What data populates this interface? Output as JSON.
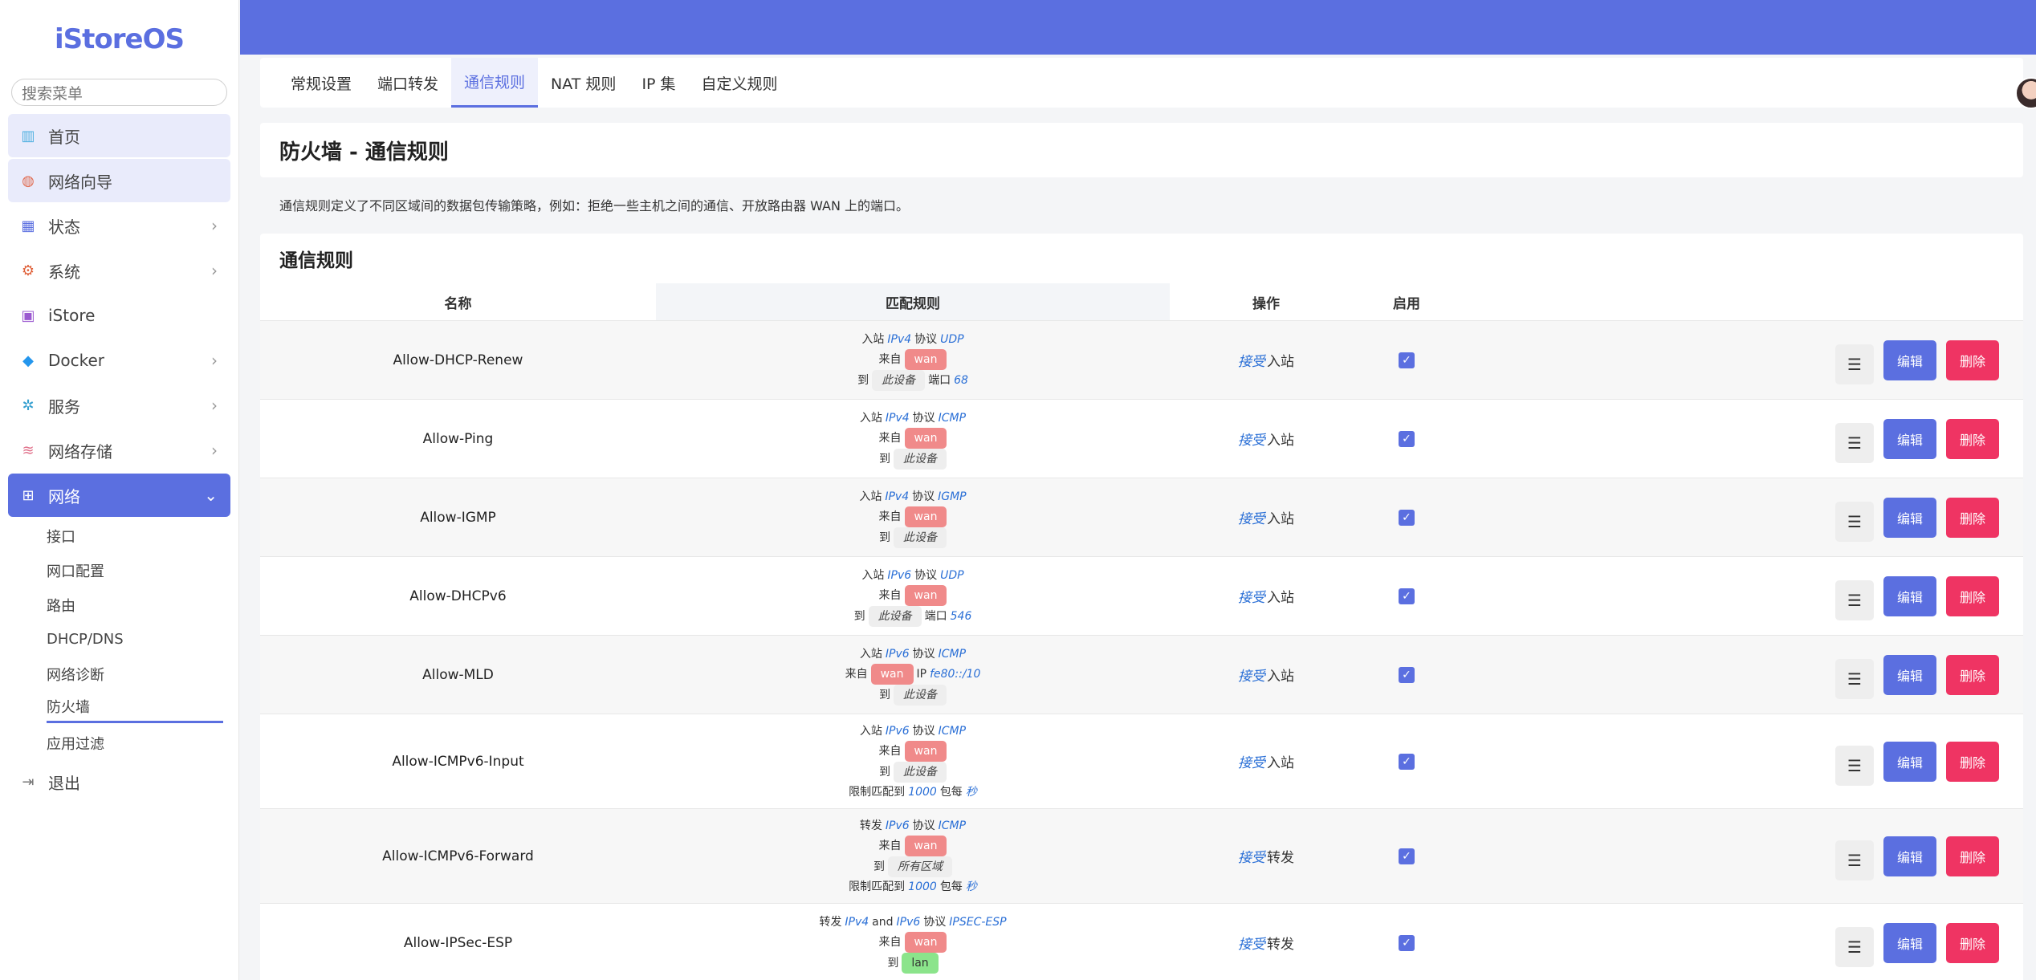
{
  "brand": "iStoreOS",
  "search": {
    "placeholder": "搜索菜单"
  },
  "sidebar": {
    "items": [
      {
        "label": "首页"
      },
      {
        "label": "网络向导"
      },
      {
        "label": "状态"
      },
      {
        "label": "系统"
      },
      {
        "label": "iStore"
      },
      {
        "label": "Docker"
      },
      {
        "label": "服务"
      },
      {
        "label": "网络存储"
      },
      {
        "label": "网络"
      }
    ],
    "sub": [
      "接口",
      "网口配置",
      "路由",
      "DHCP/DNS",
      "网络诊断",
      "防火墙",
      "应用过滤"
    ],
    "logout": "退出"
  },
  "tabs": [
    "常规设置",
    "端口转发",
    "通信规则",
    "NAT 规则",
    "IP 集",
    "自定义规则"
  ],
  "page_title": "防火墙 - 通信规则",
  "description": "通信规则定义了不同区域间的数据包传输策略，例如：拒绝一些主机之间的通信、开放路由器 WAN 上的端口。",
  "section_title": "通信规则",
  "table": {
    "headers": [
      "名称",
      "匹配规则",
      "操作",
      "启用"
    ],
    "rows": [
      {
        "name": "Allow-DHCP-Renew",
        "dir": "入站",
        "fam": "IPv4",
        "proto": "UDP",
        "from": "wan",
        "to": "此设备",
        "port": "68",
        "op_em": "接受",
        "op": "入站"
      },
      {
        "name": "Allow-Ping",
        "dir": "入站",
        "fam": "IPv4",
        "proto": "ICMP",
        "from": "wan",
        "to": "此设备",
        "op_em": "接受",
        "op": "入站"
      },
      {
        "name": "Allow-IGMP",
        "dir": "入站",
        "fam": "IPv4",
        "proto": "IGMP",
        "from": "wan",
        "to": "此设备",
        "op_em": "接受",
        "op": "入站"
      },
      {
        "name": "Allow-DHCPv6",
        "dir": "入站",
        "fam": "IPv6",
        "proto": "UDP",
        "from": "wan",
        "to": "此设备",
        "port": "546",
        "op_em": "接受",
        "op": "入站"
      },
      {
        "name": "Allow-MLD",
        "dir": "入站",
        "fam": "IPv6",
        "proto": "ICMP",
        "from": "wan",
        "ip": "fe80::/10",
        "to": "此设备",
        "op_em": "接受",
        "op": "入站"
      },
      {
        "name": "Allow-ICMPv6-Input",
        "dir": "入站",
        "fam": "IPv6",
        "proto": "ICMP",
        "from": "wan",
        "to": "此设备",
        "limit": "1000",
        "unit": "秒",
        "op_em": "接受",
        "op": "入站"
      },
      {
        "name": "Allow-ICMPv6-Forward",
        "dir": "转发",
        "fam": "IPv6",
        "proto": "ICMP",
        "from": "wan",
        "to": "所有区域",
        "limit": "1000",
        "unit": "秒",
        "op_em": "接受",
        "op": "转发"
      },
      {
        "name": "Allow-IPSec-ESP",
        "dir": "转发",
        "fam": "IPv4",
        "fam2": "IPv6",
        "proto": "IPSEC-ESP",
        "from": "wan",
        "to": "lan",
        "op_em": "接受",
        "op": "转发"
      }
    ]
  },
  "labels": {
    "proto": "协议",
    "from": "来自",
    "to": "到",
    "port": "端口",
    "and": "and",
    "limit": "限制匹配到",
    "per": "包每",
    "ip": "IP",
    "menu": "☰",
    "edit": "编辑",
    "delete": "删除",
    "check": "✓"
  }
}
